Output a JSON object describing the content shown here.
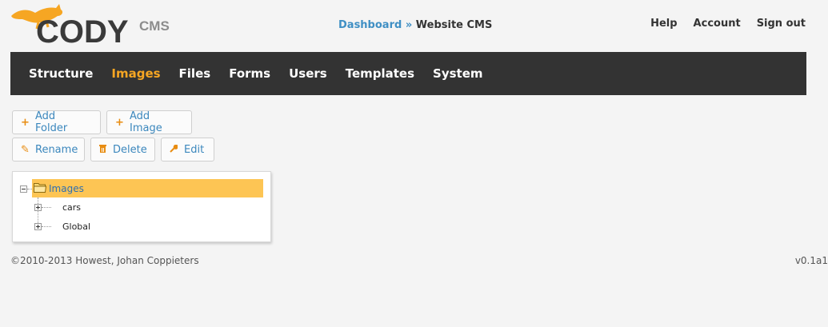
{
  "logo": {
    "text": "CODY",
    "suffix": "CMS"
  },
  "breadcrumb": {
    "link": "Dashboard",
    "separator": "»",
    "current": "Website CMS"
  },
  "topnav": [
    "Help",
    "Account",
    "Sign out"
  ],
  "menu": {
    "items": [
      "Structure",
      "Images",
      "Files",
      "Forms",
      "Users",
      "Templates",
      "System"
    ],
    "active": "Images"
  },
  "toolbar": {
    "add_folder": "Add Folder",
    "add_image": "Add Image",
    "rename": "Rename",
    "delete": "Delete",
    "edit": "Edit"
  },
  "tree": {
    "root": "Images",
    "children": [
      "cars",
      "Global"
    ]
  },
  "footer": {
    "copyright": "©2010-2013 Howest, Johan Coppieters",
    "version": "v0.1a1"
  },
  "colors": {
    "accent": "#f6a623",
    "link": "#3f8fc4",
    "menubar": "#333333",
    "selection": "#fdc554"
  }
}
